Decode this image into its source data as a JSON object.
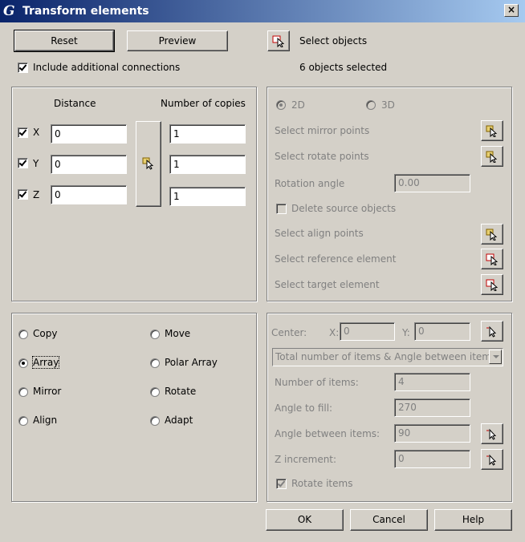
{
  "window": {
    "title": "Transform elements",
    "logo": "G",
    "close": "×"
  },
  "top": {
    "reset_label": "Reset",
    "preview_label": "Preview",
    "select_objects_label": "Select objects",
    "objects_selected": "6 objects selected",
    "include_connections_label": "Include additional connections"
  },
  "distance_panel": {
    "distance_header": "Distance",
    "copies_header": "Number of copies",
    "rows": [
      {
        "axis": "X",
        "distance": "0",
        "copies": "1"
      },
      {
        "axis": "Y",
        "distance": "0",
        "copies": "1"
      },
      {
        "axis": "Z",
        "distance": "0",
        "copies": "1"
      }
    ]
  },
  "mirror_panel": {
    "mode_2d": "2D",
    "mode_3d": "3D",
    "select_mirror_points": "Select mirror points",
    "select_rotate_points": "Select rotate points",
    "rotation_angle_label": "Rotation angle",
    "rotation_angle_value": "0.00",
    "delete_source_label": "Delete source objects",
    "select_align_points": "Select align points",
    "select_reference_element": "Select reference element",
    "select_target_element": "Select target element"
  },
  "operations": {
    "copy": "Copy",
    "move": "Move",
    "array": "Array",
    "polar_array": "Polar Array",
    "mirror": "Mirror",
    "rotate": "Rotate",
    "align": "Align",
    "adapt": "Adapt",
    "selected": "Array"
  },
  "polar_panel": {
    "center_label": "Center:",
    "x_label": "X:",
    "x_value": "0",
    "y_label": "Y:",
    "y_value": "0",
    "mode_selected": "Total number of items & Angle between items",
    "number_of_items_label": "Number of items:",
    "number_of_items_value": "4",
    "angle_to_fill_label": "Angle to fill:",
    "angle_to_fill_value": "270",
    "angle_between_label": "Angle between items:",
    "angle_between_value": "90",
    "z_increment_label": "Z increment:",
    "z_increment_value": "0",
    "rotate_items_label": "Rotate items"
  },
  "footer": {
    "ok_label": "OK",
    "cancel_label": "Cancel",
    "help_label": "Help"
  }
}
